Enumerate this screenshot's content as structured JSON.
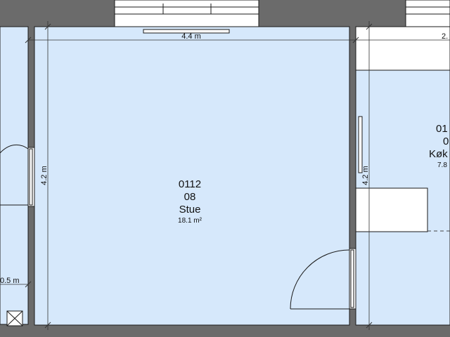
{
  "rooms": {
    "main": {
      "number": "0112",
      "code": "08",
      "name": "Stue",
      "area": "18.1 m²"
    },
    "right": {
      "number": "01",
      "code": "0",
      "name": "Køk",
      "area": "7.8"
    }
  },
  "dimensions": {
    "main_width": "4.4 m",
    "main_height": "4.2 m",
    "right_height": "4.2 m",
    "right_width_partial": "2.",
    "left_width_partial": "0.5 m"
  },
  "colors": {
    "room_fill": "#d6e8fb",
    "wall": "#6b6b6b",
    "outline": "#1a1a1a"
  }
}
